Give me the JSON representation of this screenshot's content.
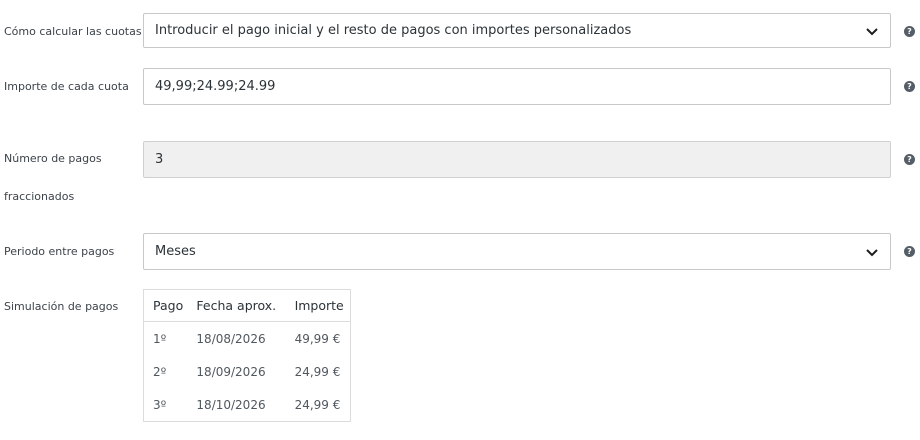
{
  "form": {
    "calc_method": {
      "label": "Cómo calcular las cuotas",
      "value": "Introducir el pago inicial y el resto de pagos con importes personalizados"
    },
    "installment_amount": {
      "label": "Importe de cada cuota",
      "value": "49,99;24.99;24.99"
    },
    "num_payments": {
      "label_line1": "Número de pagos",
      "label_line2": "fraccionados",
      "value": "3"
    },
    "period": {
      "label": "Periodo entre pagos",
      "value": "Meses"
    },
    "simulation": {
      "label": "Simulación de pagos",
      "headers": [
        "Pago",
        "Fecha aprox.",
        "Importe"
      ],
      "rows": [
        [
          "1º",
          "18/08/2026",
          "49,99 €"
        ],
        [
          "2º",
          "18/09/2026",
          "24,99 €"
        ],
        [
          "3º",
          "18/10/2026",
          "24,99 €"
        ]
      ]
    }
  },
  "help_glyph": "?",
  "icons": {
    "select_arrow": "chevron-down-icon",
    "help": "question-circle-icon"
  }
}
